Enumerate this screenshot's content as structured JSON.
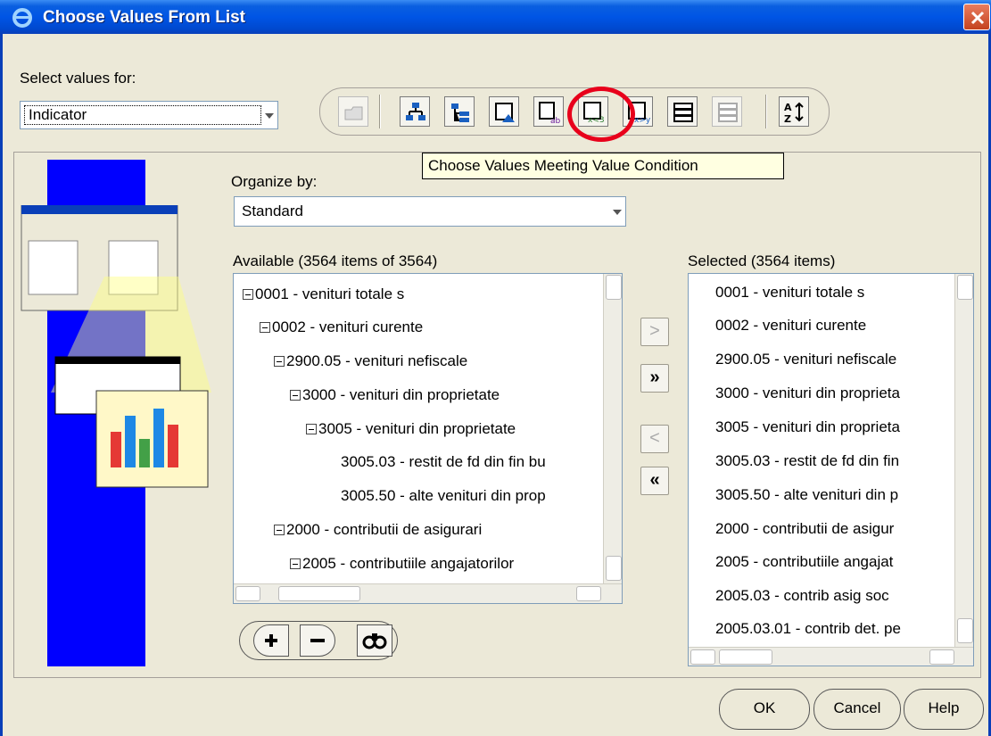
{
  "window": {
    "title": "Choose Values From List"
  },
  "select_values": {
    "label": "Select values for:",
    "value": "Indicator"
  },
  "tooltip": "Choose Values Meeting Value Condition",
  "organize": {
    "label": "Organize by:",
    "value": "Standard"
  },
  "available": {
    "header": "Available (3564 items of 3564)",
    "items": [
      {
        "label": "0001 - venituri totale s",
        "expander": true
      },
      {
        "label": "0002 - venituri curente",
        "expander": true
      },
      {
        "label": "2900.05 - venituri nefiscale",
        "expander": true
      },
      {
        "label": "3000 - venituri din proprietate",
        "expander": true
      },
      {
        "label": "3005 - venituri din proprietate",
        "expander": true
      },
      {
        "label": "3005.03 - restit de fd din fin bu",
        "expander": false
      },
      {
        "label": "3005.50 - alte venituri din prop",
        "expander": false
      },
      {
        "label": "2000 - contributii de asigurari",
        "expander": true
      },
      {
        "label": "2005 - contributiile angajatorilor",
        "expander": true
      }
    ]
  },
  "selected": {
    "header": "Selected (3564 items)",
    "items": [
      "0001 - venituri totale s",
      "0002 - venituri curente",
      "2900.05 - venituri nefiscale",
      "3000 - venituri din proprieta",
      "3005 - venituri din proprieta",
      "3005.03 - restit de fd din fin",
      "3005.50 - alte venituri din p",
      "2000 - contributii de asigur",
      "2005 - contributiile angajat",
      "2005.03 - contrib asig soc",
      "2005.03.01 - contrib det. pe"
    ]
  },
  "move_buttons": {
    "add": ">",
    "add_all": "»",
    "remove": "<",
    "remove_all": "«"
  },
  "buttons": {
    "ok": "OK",
    "cancel": "Cancel",
    "help": "Help"
  },
  "icons": [
    "ie-icon",
    "close-icon",
    "folder-icon",
    "hierarchy-icon",
    "hierarchy-level-icon",
    "select-top-icon",
    "text-condition-icon",
    "value-condition-icon",
    "compare-icon",
    "select-all-icon",
    "deselect-icon",
    "sort-icon",
    "expand-icon",
    "collapse-icon",
    "find-icon"
  ]
}
